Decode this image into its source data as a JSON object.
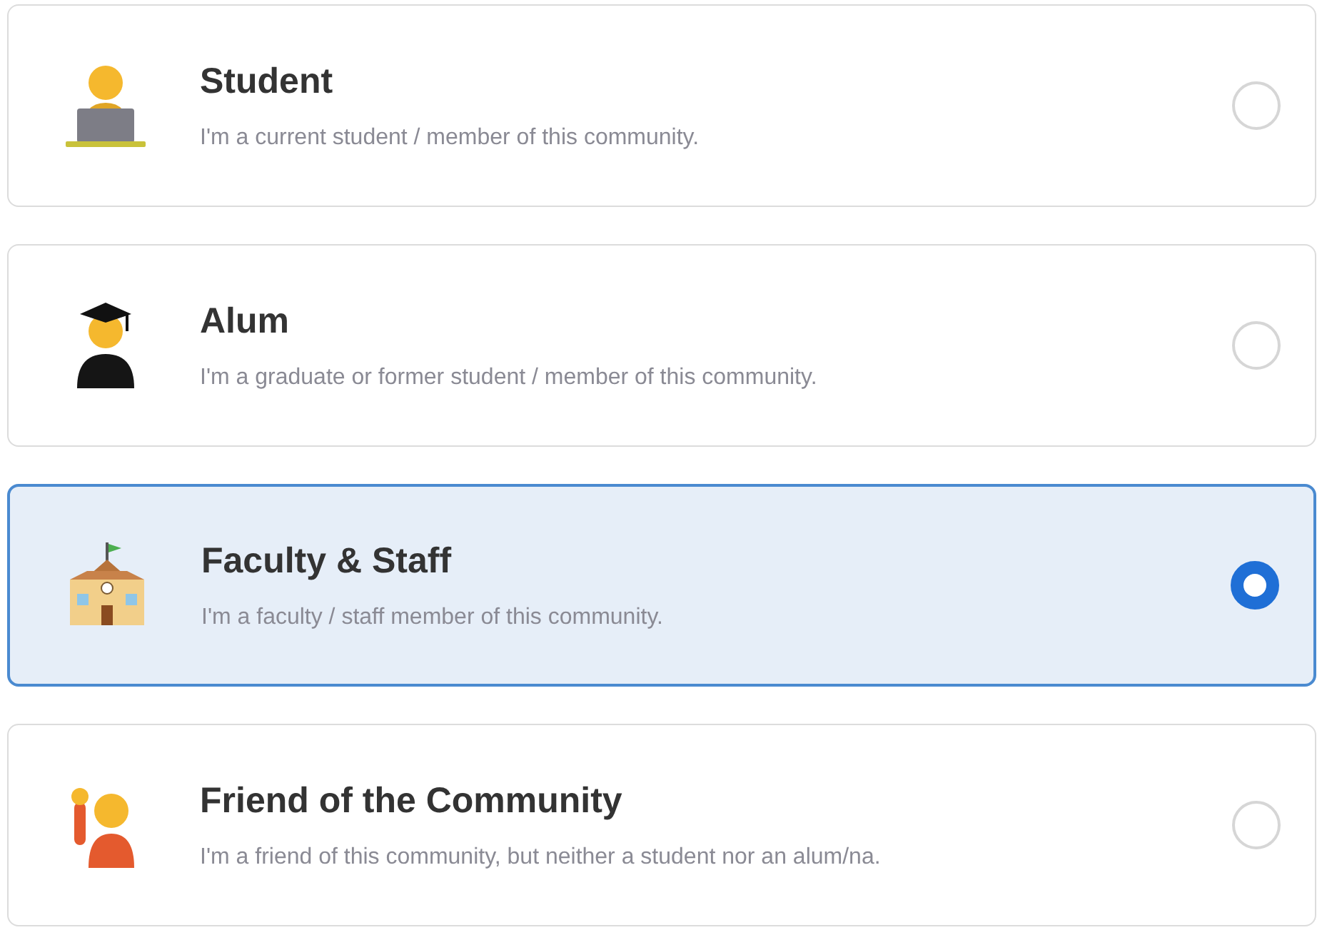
{
  "options": [
    {
      "kind": "student",
      "title": "Student",
      "description": "I'm a current student / member of this community.",
      "selected": false
    },
    {
      "kind": "alum",
      "title": "Alum",
      "description": "I'm a graduate or former student / member of this community.",
      "selected": false
    },
    {
      "kind": "school",
      "title": "Faculty & Staff",
      "description": "I'm a faculty / staff member of this community.",
      "selected": true
    },
    {
      "kind": "friend",
      "title": "Friend of the Community",
      "description": "I'm a friend of this community, but neither a student nor an alum/na.",
      "selected": false
    }
  ]
}
